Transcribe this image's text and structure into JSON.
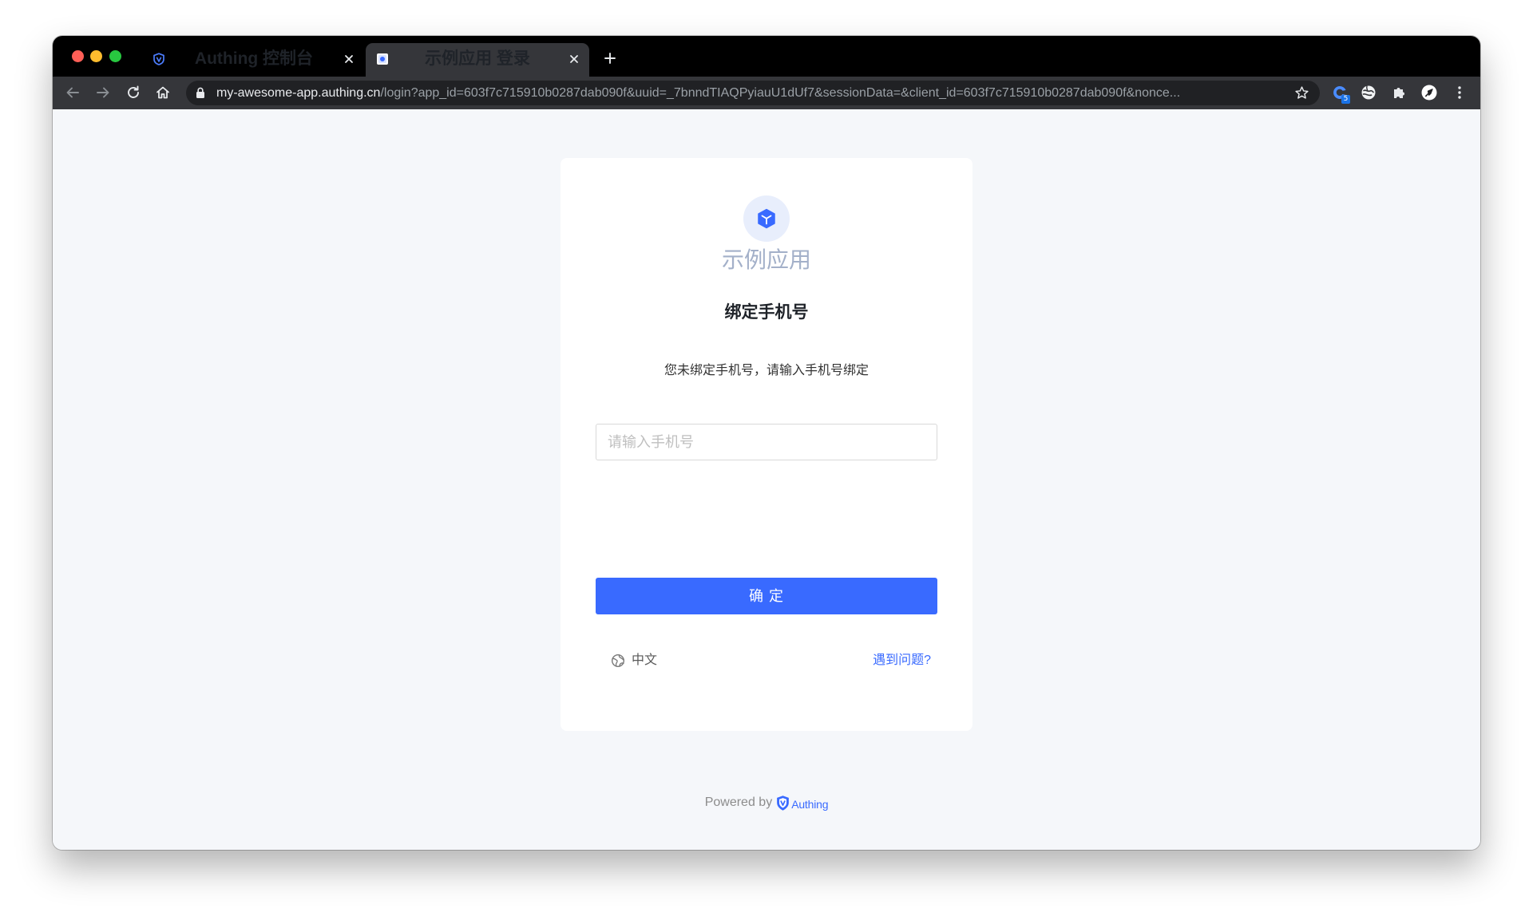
{
  "browser": {
    "tabs": [
      {
        "title": "Authing 控制台",
        "icon": "authing-shield-icon",
        "active": false
      },
      {
        "title": "示例应用 登录",
        "icon": "app-favicon-icon",
        "active": true
      }
    ],
    "new_tab_icon": "plus-icon",
    "toolbar_icons": [
      "back-arrow-icon",
      "forward-arrow-icon",
      "reload-icon",
      "home-icon"
    ],
    "address_bar": {
      "secure_icon": "lock-icon",
      "host": "my-awesome-app.authing.cn",
      "path": "/login?app_id=603f7c715910b0287dab090f&uuid=_7bnndTIAQPyiauU1dUf7&sessionData=&client_id=603f7c715910b0287dab090f&nonce...",
      "bookmark_icon": "bookmark-star-icon"
    },
    "extensions": [
      {
        "icon": "extension-blue-icon",
        "badge": "5"
      },
      {
        "icon": "extension-globe-icon"
      },
      {
        "icon": "puzzle-piece-icon"
      },
      {
        "icon": "profile-avatar-icon"
      },
      {
        "icon": "more-vert-icon"
      }
    ]
  },
  "app": {
    "name": "示例应用",
    "logo_icon": "cube-icon"
  },
  "form": {
    "title": "绑定手机号",
    "description": "您未绑定手机号，请输入手机号绑定",
    "phone": {
      "placeholder": "请输入手机号",
      "value": ""
    },
    "submit_label": "确 定"
  },
  "card_footer": {
    "language_icon": "globe-icon",
    "language": "中文",
    "help_link": "遇到问题?"
  },
  "page_footer": {
    "powered_by": "Powered by",
    "brand_icon": "authing-shield-icon",
    "brand": "Authing"
  },
  "colors": {
    "accent": "#396aff",
    "tab_strip": "#000000",
    "toolbar": "#35363a",
    "omnibox": "#202124",
    "content_bg": "#f5f7fa",
    "card_bg": "#ffffff",
    "app_name": "#a3b0c9",
    "logo_bg": "#e8eefc",
    "traffic_close": "#ff5f57",
    "traffic_minimize": "#febc2e",
    "traffic_zoom": "#28c840",
    "url_host": "#e8eaed",
    "url_path": "#9aa0a6"
  }
}
